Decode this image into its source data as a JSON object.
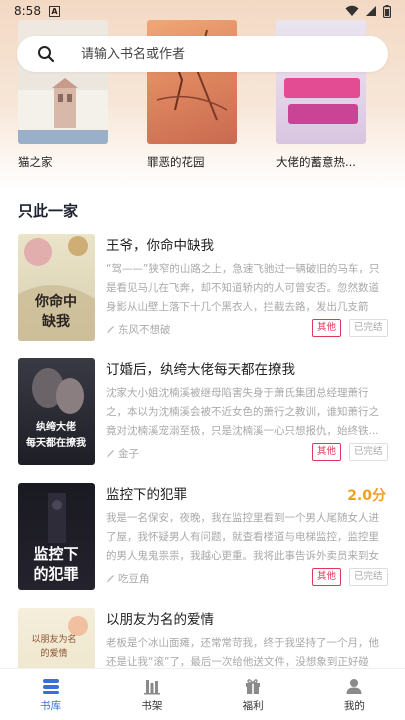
{
  "status_bar": {
    "time": "8:58"
  },
  "search": {
    "placeholder": "请输入书名或作者"
  },
  "top_covers": [
    {
      "title": "猫之家"
    },
    {
      "title": "罪恶的花园"
    },
    {
      "title": "大佬的蓄意热..."
    }
  ],
  "section": {
    "title": "只此一家"
  },
  "books": [
    {
      "title": "王爷，你命中缺我",
      "desc": "“驾——”狭窄的山路之上，急速飞驰过一辆破旧的马车，只是看见马儿在飞奔，却不知道轿内的人可曾安否。忽然数道身影从山壁上落下十几个黑衣人，拦截去路，发出几支箭羽，将还没...",
      "author": "东风不想破",
      "category": "其他",
      "status": "已完结",
      "rating": ""
    },
    {
      "title": "订婚后，纨绔大佬每天都在撩我",
      "desc": "沈家大小姐沈楠溪被继母陷害失身于萧氏集团总经理萧行之，本以为沈楠溪会被不近女色的萧行之教训，谁知萧行之竟对沈楠溪宠溺至极，只是沈楠溪一心只想报仇，始终铁...",
      "author": "金子",
      "category": "其他",
      "status": "已完结",
      "rating": ""
    },
    {
      "title": "监控下的犯罪",
      "desc": "我是一名保安，夜晚，我在监控里看到一个男人尾随女人进了屋，我怀疑男人有问题，就查看楼道与电梯监控，监控里的男人鬼鬼祟祟，我越心更重。我将此事告诉外卖员来到女人门...",
      "author": "吃豆角",
      "category": "其他",
      "status": "已完结",
      "rating": "2.0分"
    },
    {
      "title": "以朋友为名的爱情",
      "desc": "老板是个冰山面瘫，还常常苛我，终于我坚持了一个月，他还是让我“滚”了，最后一次给他送文件，没想象到正好碰上...",
      "author": "",
      "category": "",
      "status": "",
      "rating": ""
    }
  ],
  "nav": {
    "items": [
      {
        "label": "书库",
        "icon": "library-icon",
        "active": true
      },
      {
        "label": "书架",
        "icon": "bookshelf-icon",
        "active": false
      },
      {
        "label": "福利",
        "icon": "gift-icon",
        "active": false
      },
      {
        "label": "我的",
        "icon": "profile-icon",
        "active": false
      }
    ]
  },
  "colors": {
    "accent": "#3a6fd8",
    "tag_red": "#e0385a",
    "rating": "#f0a020"
  }
}
